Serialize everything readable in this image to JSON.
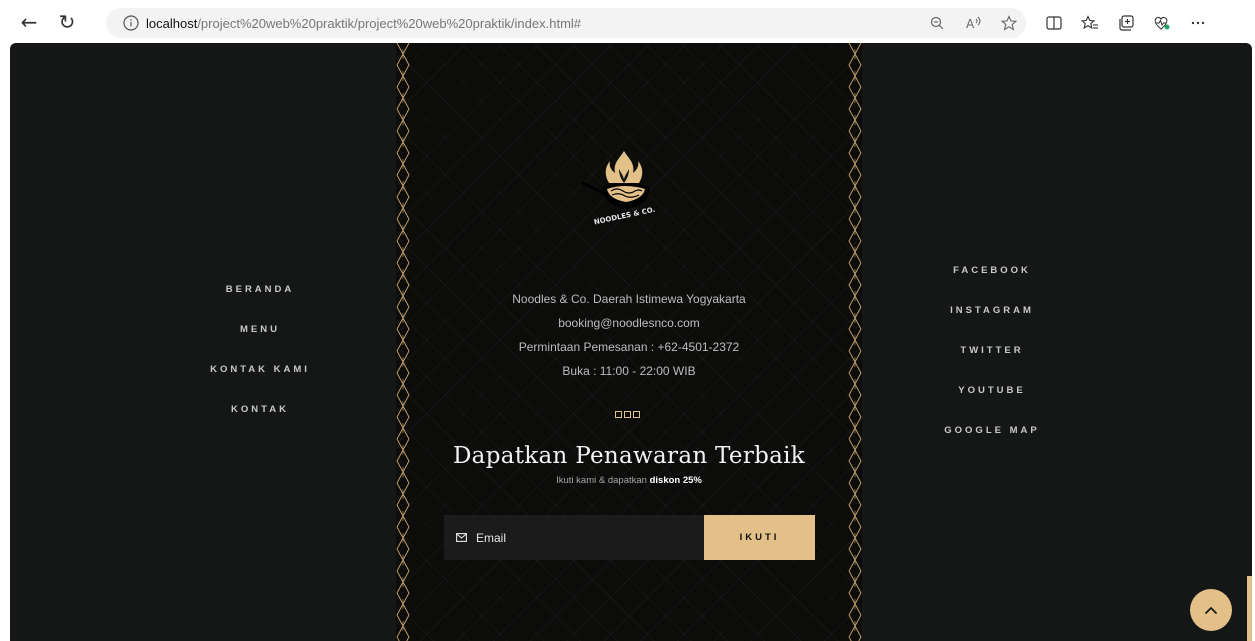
{
  "browser": {
    "url_host": "localhost",
    "url_path": "/project%20web%20praktik/project%20web%20praktik/index.html#",
    "icons": [
      "back-icon",
      "refresh-icon",
      "info-icon",
      "zoom-icon",
      "read-aloud-icon",
      "favorite-icon",
      "split-screen-icon",
      "favorites-icon",
      "collections-icon",
      "health-icon",
      "more-icon"
    ]
  },
  "nav_left": [
    "BERANDA",
    "MENU",
    "KONTAK KAMI",
    "KONTAK"
  ],
  "nav_right": [
    "FACEBOOK",
    "INSTAGRAM",
    "TWITTER",
    "YOUTUBE",
    "GOOGLE MAP"
  ],
  "logo": {
    "text": "NOODLES & CO."
  },
  "info": {
    "address": "Noodles & Co. Daerah Istimewa Yogyakarta",
    "email": "booking@noodlesnco.com",
    "phone": "Permintaan Pemesanan : +62-4501-2372",
    "hours": "Buka : 11:00 - 22:00 WIB"
  },
  "promo": {
    "title": "Dapatkan Penawaran Terbaik",
    "subtitle_prefix": "Ikuti kami & dapatkan",
    "subtitle_bold": "diskon 25%",
    "email_placeholder": "Email",
    "button_label": "IKUTI"
  },
  "colors": {
    "accent": "#e3c088",
    "page_bg": "#151616",
    "panel_bg": "#0c0c0b"
  }
}
